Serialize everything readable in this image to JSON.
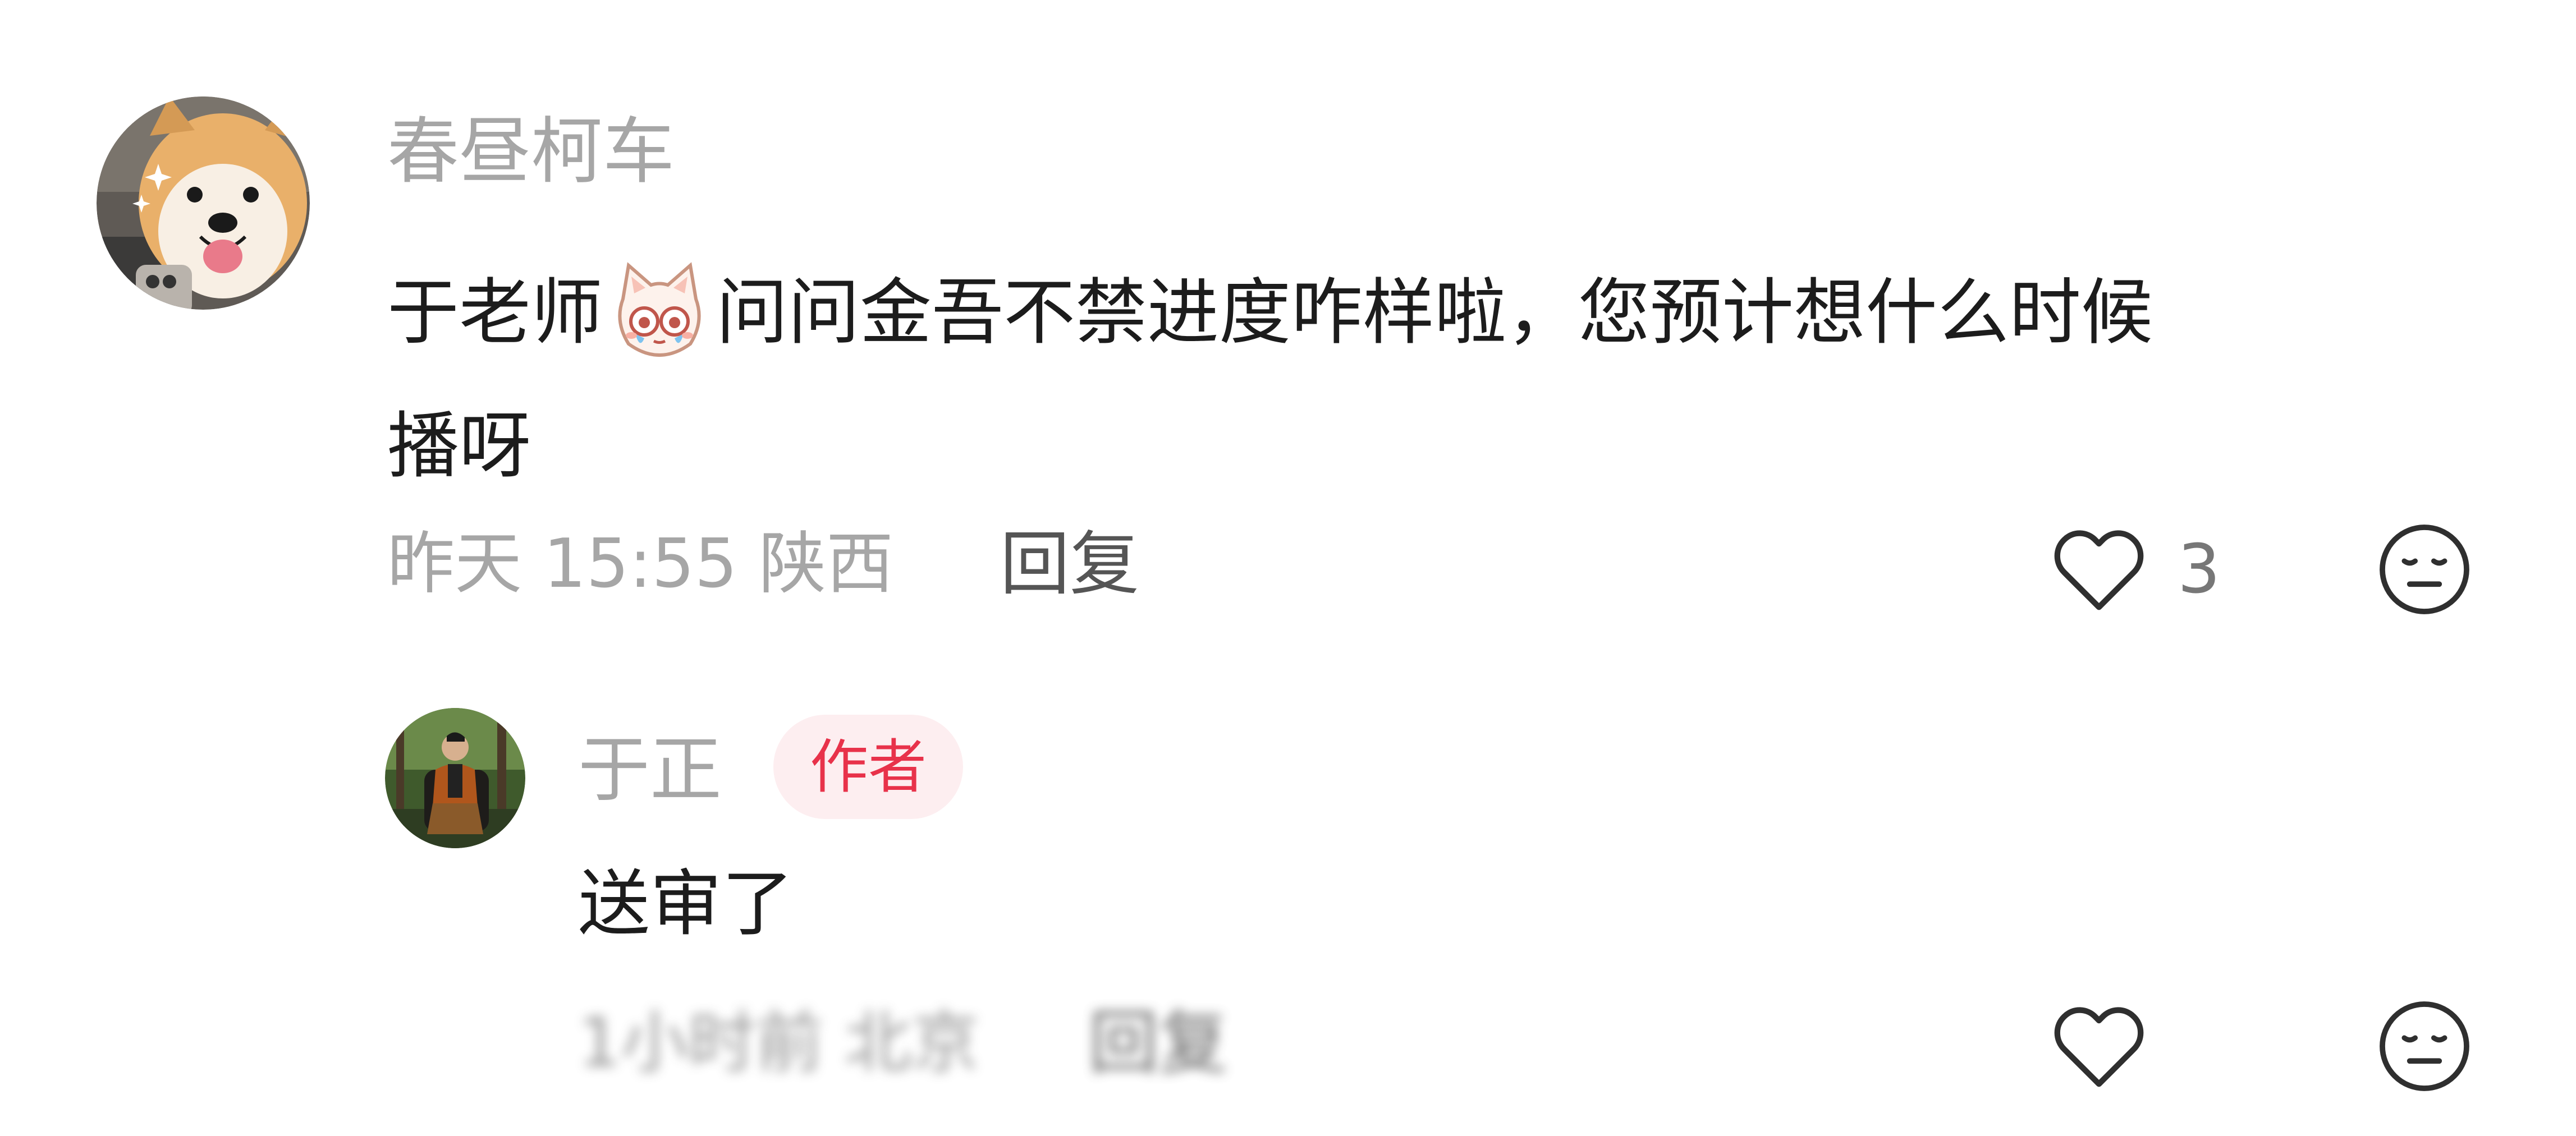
{
  "comment": {
    "username": "春昼柯车",
    "text_before_emoji": "于老师",
    "emoji": "crying-cat-emoji",
    "text_after_emoji": "问问金吾不禁进度咋样啦，您预计想什么时候",
    "text_line2": "播呀",
    "timestamp": "昨天 15:55",
    "location": "陕西",
    "reply_label": "回复",
    "like_count": "3",
    "like_icon": "heart-outline-icon",
    "dislike_icon": "neutral-face-icon"
  },
  "reply": {
    "username": "于正",
    "badge": "作者",
    "text": "送审了",
    "meta_blurred": "1小时前 北京",
    "reply_label": "回复",
    "like_icon": "heart-outline-icon",
    "dislike_icon": "neutral-face-icon"
  },
  "colors": {
    "text_primary": "#1c1c1c",
    "text_secondary": "#a6a6a6",
    "badge_bg": "#fdeef0",
    "badge_text": "#e8324a"
  }
}
